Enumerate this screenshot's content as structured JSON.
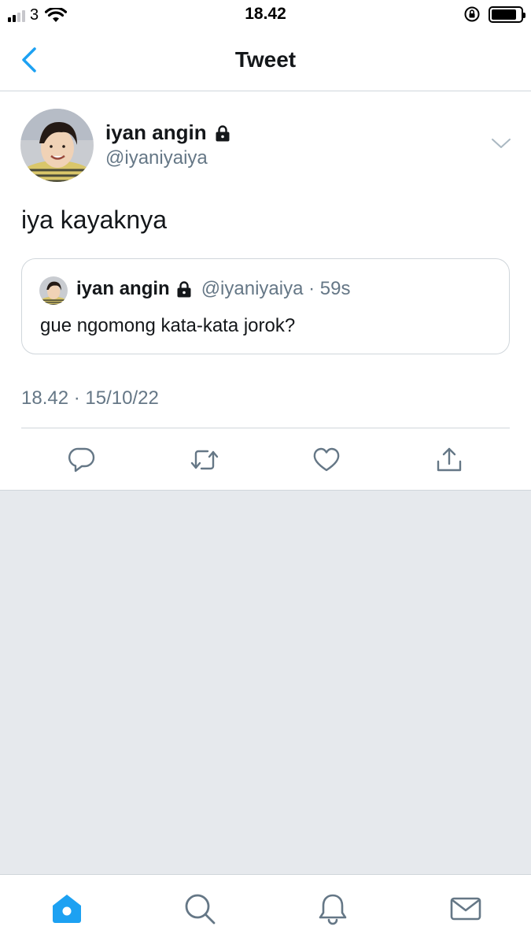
{
  "status_bar": {
    "carrier": "3",
    "time": "18.42",
    "signal_icon": "signal-bars-icon",
    "wifi_icon": "wifi-icon",
    "rotation_lock_icon": "rotation-lock-icon",
    "battery_icon": "battery-icon",
    "battery_level": 0.85
  },
  "nav": {
    "title": "Tweet",
    "back_icon": "chevron-left-icon"
  },
  "tweet": {
    "author_name": "iyan angin",
    "author_handle": "@iyaniyaiya",
    "protected_icon": "lock-icon",
    "menu_icon": "chevron-down-icon",
    "text": "iya kayaknya",
    "timestamp": "18.42 · 15/10/22",
    "quoted": {
      "author_name": "iyan angin",
      "meta": "@iyaniyaiya · 59s",
      "text": "gue ngomong kata-kata jorok?"
    },
    "actions": [
      "reply-icon",
      "retweet-icon",
      "like-icon",
      "share-icon"
    ]
  },
  "tab_bar": {
    "tabs": [
      "home-icon",
      "search-icon",
      "notifications-icon",
      "messages-icon"
    ],
    "active": "home"
  },
  "colors": {
    "accent": "#1da1f2",
    "text": "#14171a",
    "secondary": "#657786",
    "border": "#d0d6db",
    "empty_bg": "#e6e9ed"
  }
}
